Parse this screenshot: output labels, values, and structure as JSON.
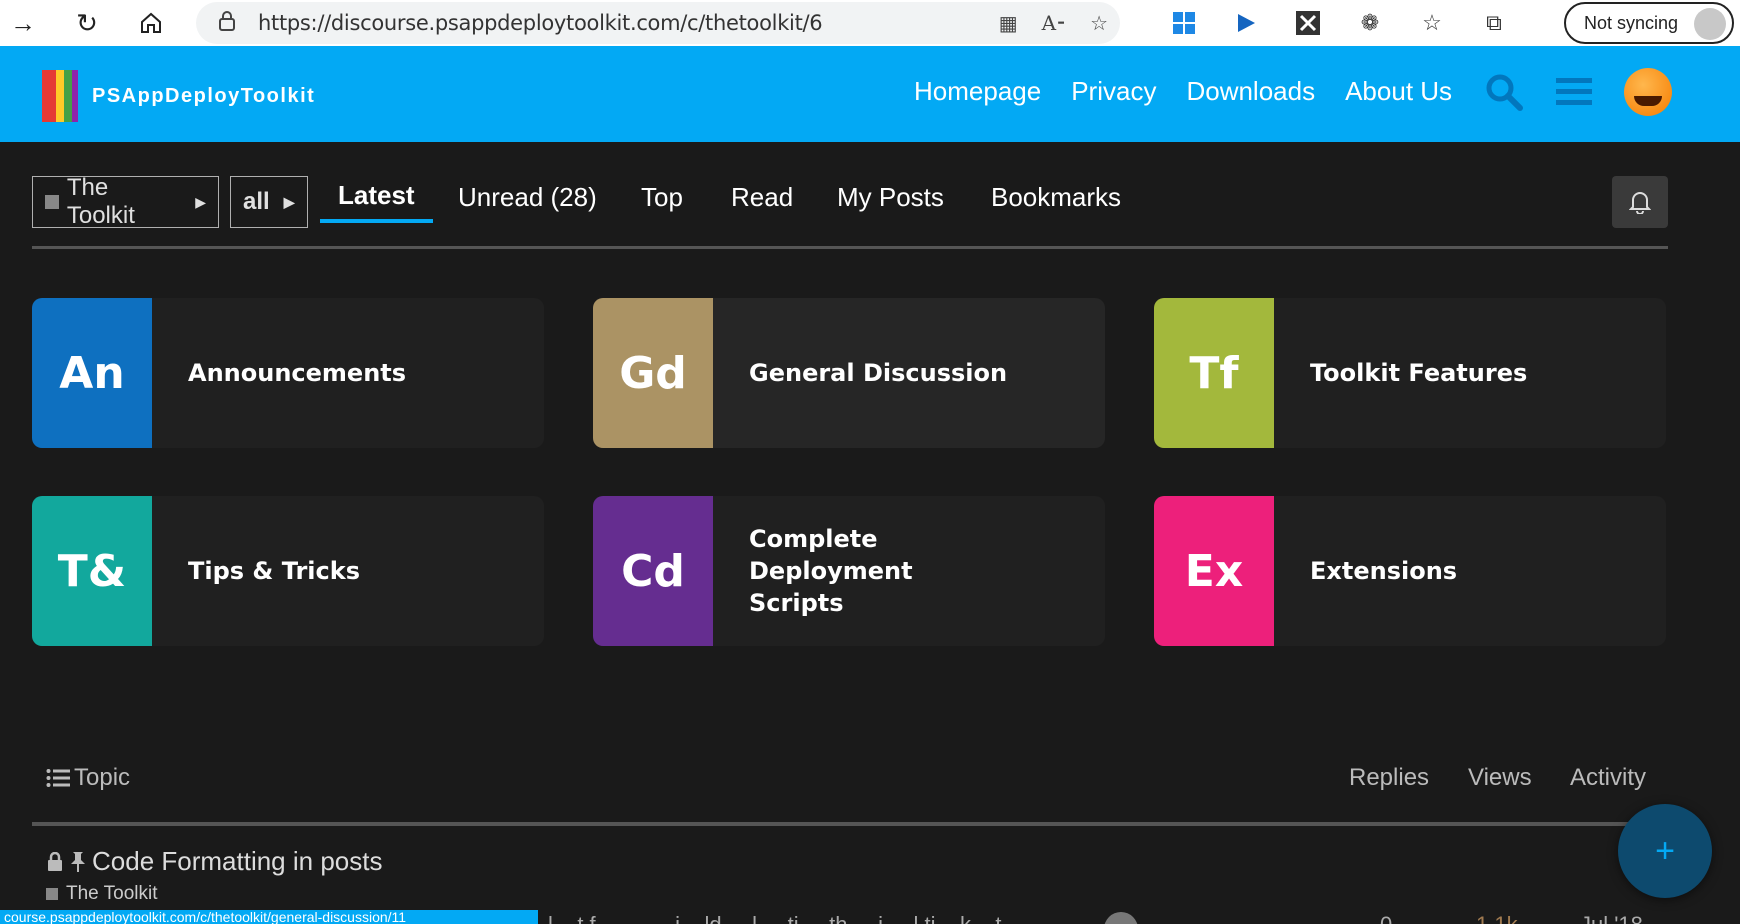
{
  "browser": {
    "url": "https://discourse.psappdeploytoolkit.com/c/thetoolkit/6",
    "sync_label": "Not syncing"
  },
  "site": {
    "logo_text": "PSAppDeployToolkit",
    "links": [
      "Homepage",
      "Privacy",
      "Downloads",
      "About Us"
    ],
    "accent_color": "#03a9f4"
  },
  "nav": {
    "category_crumb": "The Toolkit",
    "subcategory_crumb": "all",
    "tabs": [
      "Latest",
      "Unread (28)",
      "Top",
      "Read",
      "My Posts",
      "Bookmarks"
    ],
    "active_tab": "Latest"
  },
  "categories": [
    {
      "abbr": "An",
      "name": "Announcements",
      "color": "#0e70c0"
    },
    {
      "abbr": "Gd",
      "name": "General Discussion",
      "color": "#ab9364"
    },
    {
      "abbr": "Tf",
      "name": "Toolkit Features",
      "color": "#a3b83c"
    },
    {
      "abbr": "T&",
      "name": "Tips & Tricks",
      "color": "#12a89d"
    },
    {
      "abbr": "Cd",
      "name": "Complete Deployment Scripts",
      "color": "#652d90"
    },
    {
      "abbr": "Ex",
      "name": "Extensions",
      "color": "#ed207b"
    }
  ],
  "topic_list": {
    "headers": {
      "topic": "Topic",
      "replies": "Replies",
      "views": "Views",
      "activity": "Activity"
    },
    "rows": [
      {
        "title": "Code Formatting in posts",
        "category": "The Toolkit"
      }
    ],
    "partial_row": {
      "excerpt": "l  ...t  f  ...  ...  ... i  ...ld  ... l  ... ti  ... th  ... i  ... l ti  ...k  ...t",
      "replies": "0",
      "views": "1.1k",
      "activity": "Jul '18"
    }
  },
  "status_bar_url": "course.psappdeploytoolkit.com/c/thetoolkit/general-discussion/11"
}
